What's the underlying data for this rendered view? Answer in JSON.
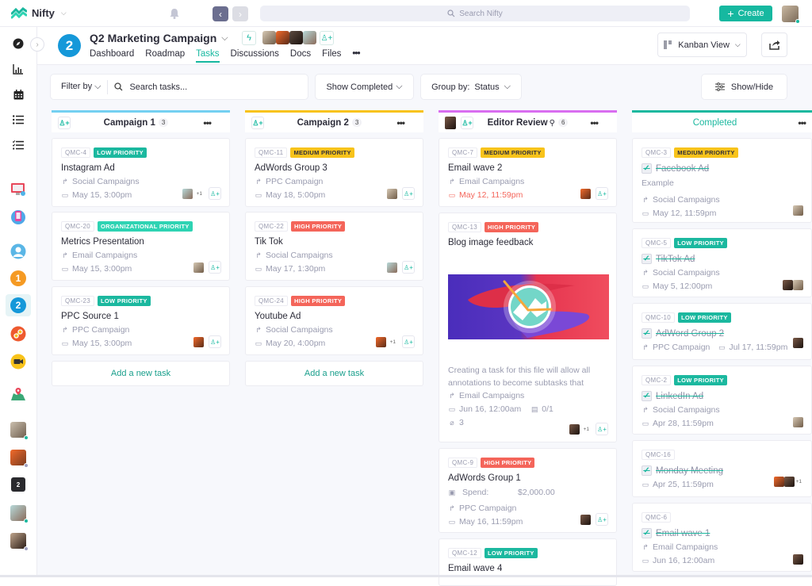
{
  "app": {
    "name": "Nifty",
    "search_placeholder": "Search Nifty",
    "create_label": "Create",
    "brand_color": "#16b8a0"
  },
  "sidebar": {
    "nav_icons": [
      "compass-icon",
      "chart-icon",
      "calendar-icon",
      "list-icon",
      "checklist-icon"
    ],
    "projects": [
      {
        "name": "monitor-project-icon"
      },
      {
        "name": "phone-project-icon"
      },
      {
        "name": "user-project-icon"
      },
      {
        "name": "project-1",
        "label": "1",
        "color": "#f59a23"
      },
      {
        "name": "project-2",
        "label": "2",
        "color": "#1598d9",
        "active": true
      },
      {
        "name": "link-project-icon"
      },
      {
        "name": "camera-project-icon"
      },
      {
        "name": "map-project-icon"
      }
    ],
    "dm_badge": "2"
  },
  "project": {
    "badge": "2",
    "title": "Q2 Marketing Campaign",
    "tabs": [
      "Dashboard",
      "Roadmap",
      "Tasks",
      "Discussions",
      "Docs",
      "Files"
    ],
    "active_tab": "Tasks",
    "more_label": "•••",
    "view_label": "Kanban View"
  },
  "filters": {
    "filter_label": "Filter by",
    "search_placeholder": "Search tasks...",
    "show_completed_label": "Show Completed",
    "group_by_label": "Group by:",
    "group_by_value": "Status",
    "show_hide_label": "Show/Hide"
  },
  "columns": [
    {
      "title": "Campaign 1",
      "count": "3",
      "color": "#74d0f1",
      "cards": [
        {
          "id": "QMC-4",
          "priority": "LOW PRIORITY",
          "title": "Instagram Ad",
          "list": "Social Campaigns",
          "date": "May 15, 3:00pm",
          "extra": "+1"
        },
        {
          "id": "QMC-20",
          "priority": "ORGANIZATIONAL PRIORITY",
          "title": "Metrics Presentation",
          "list": "Email Campaigns",
          "date": "May 15, 3:00pm"
        },
        {
          "id": "QMC-23",
          "priority": "LOW PRIORITY",
          "title": "PPC Source 1",
          "list": "PPC Campaign",
          "date": "May 15, 3:00pm"
        }
      ],
      "add_label": "Add a new task"
    },
    {
      "title": "Campaign 2",
      "count": "3",
      "color": "#f8c31b",
      "cards": [
        {
          "id": "QMC-11",
          "priority": "MEDIUM PRIORITY",
          "title": "AdWords Group 3",
          "list": "PPC Campaign",
          "date": "May 18, 5:00pm"
        },
        {
          "id": "QMC-22",
          "priority": "HIGH PRIORITY",
          "title": "Tik Tok",
          "list": "Social Campaigns",
          "date": "May 17, 1:30pm"
        },
        {
          "id": "QMC-24",
          "priority": "HIGH PRIORITY",
          "title": "Youtube Ad",
          "list": "Social Campaigns",
          "date": "May 20, 4:00pm",
          "extra": "+1"
        }
      ],
      "add_label": "Add a new task"
    },
    {
      "title": "Editor Review",
      "count": "6",
      "color": "#d96df0",
      "cards": [
        {
          "id": "QMC-7",
          "priority": "MEDIUM PRIORITY",
          "title": "Email wave 2",
          "list": "Email Campaigns",
          "date": "May 12, 11:59pm",
          "overdue": true
        },
        {
          "id": "QMC-13",
          "priority": "HIGH PRIORITY",
          "title": "Blog image feedback",
          "description": "Creating a task for this file will allow all annotations to become subtasks that",
          "list": "Email Campaigns",
          "date": "Jun 16, 12:00am",
          "subtasks": "0/1",
          "attachments": "3",
          "extra": "+1"
        },
        {
          "id": "QMC-9",
          "priority": "HIGH PRIORITY",
          "title": "AdWords Group 1",
          "spend_label": "Spend:",
          "spend_value": "$2,000.00",
          "list": "PPC Campaign",
          "date": "May 16, 11:59pm"
        },
        {
          "id": "QMC-12",
          "priority": "LOW PRIORITY",
          "title": "Email wave 4"
        }
      ]
    },
    {
      "title": "Completed",
      "color": "#1bb89f",
      "cards": [
        {
          "id": "QMC-3",
          "priority": "MEDIUM PRIORITY",
          "title": "Facebook Ad",
          "description": "Example",
          "list": "Social Campaigns",
          "date": "May 12, 11:59pm"
        },
        {
          "id": "QMC-5",
          "priority": "LOW PRIORITY",
          "title": "TikTok Ad",
          "list": "Social Campaigns",
          "date": "May 5, 12:00pm"
        },
        {
          "id": "QMC-10",
          "priority": "LOW PRIORITY",
          "title": "AdWord Group 2",
          "list": "PPC Campaign",
          "date": "Jul 17, 11:59pm"
        },
        {
          "id": "QMC-2",
          "priority": "LOW PRIORITY",
          "title": "LinkedIn Ad",
          "list": "Social Campaigns",
          "date": "Apr 28, 11:59pm"
        },
        {
          "id": "QMC-16",
          "title": "Monday Meeting",
          "date": "Apr 25, 11:59pm",
          "extra": "+1"
        },
        {
          "id": "QMC-6",
          "title": "Email wave 1",
          "list": "Email Campaigns",
          "date": "Jun 16, 12:00am"
        }
      ]
    }
  ]
}
